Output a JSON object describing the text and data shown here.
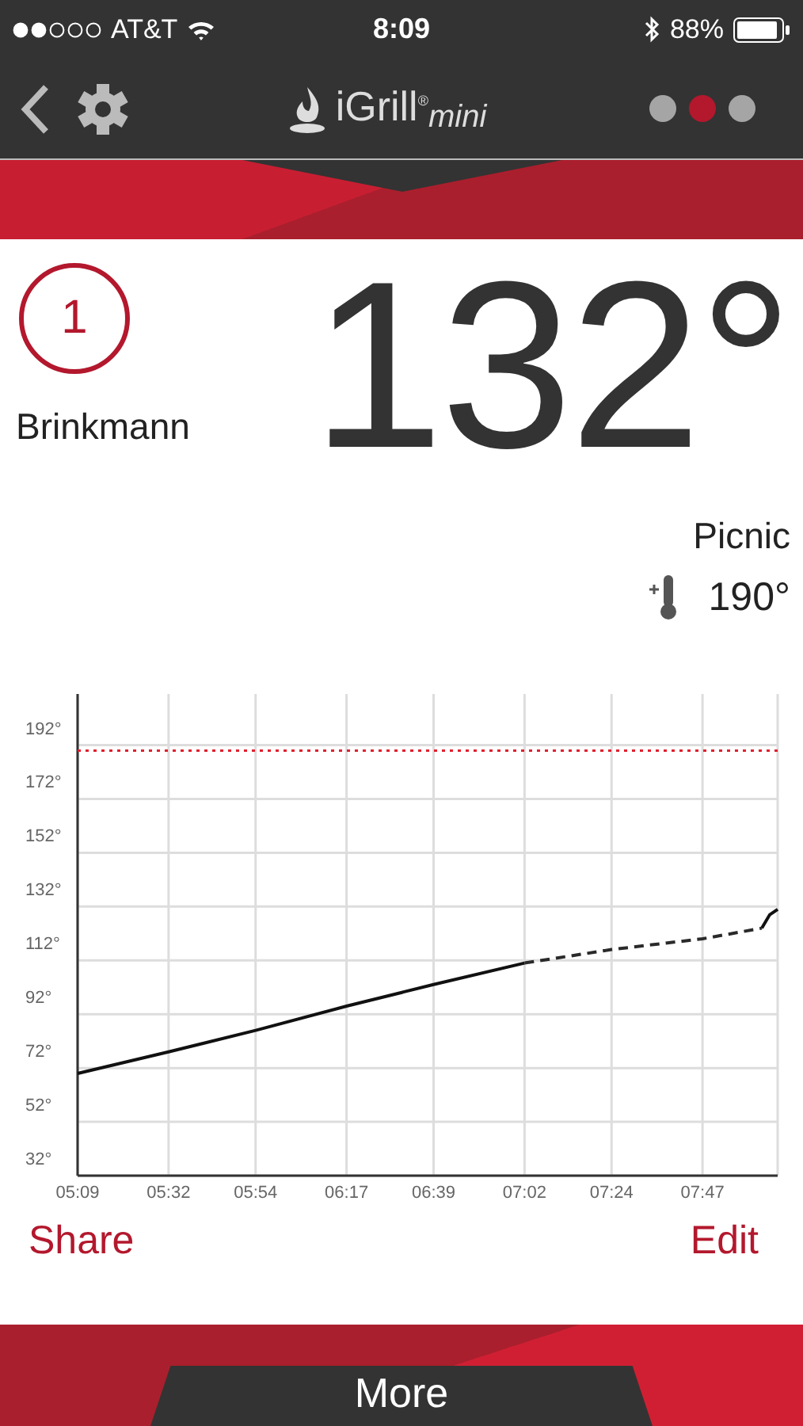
{
  "status_bar": {
    "carrier": "AT&T",
    "time": "8:09",
    "battery": "88%"
  },
  "header": {
    "logo": "iGrill$^{®}$$_{mini}$",
    "pages": [
      {
        "selected": false
      },
      {
        "selected": true
      },
      {
        "selected": false
      }
    ]
  },
  "probe": {
    "number": "1",
    "name": "Brinkmann",
    "temperature": "132°",
    "preset": "Picnic",
    "target": "190°"
  },
  "chart": {
    "chart_data": {
      "type": "line",
      "x": [
        309,
        332,
        354,
        377,
        399,
        422,
        444,
        467,
        482,
        484,
        486
      ],
      "series": [
        {
          "color": "#111111",
          "line_style": "solid",
          "values": [
            70,
            78,
            86,
            95,
            103,
            111,
            null,
            null,
            124,
            129,
            131
          ]
        },
        {
          "color": "#2a2a2a",
          "line_style": "dashed",
          "values": [
            null,
            null,
            null,
            null,
            null,
            111,
            116,
            120,
            124,
            null,
            null
          ]
        },
        {
          "color": "#e0202e",
          "line_style": "dotted",
          "values": [
            190,
            190,
            190,
            190,
            190,
            190,
            190,
            190,
            190,
            190,
            190
          ]
        }
      ],
      "grid": true,
      "xlim": [
        309,
        486
      ],
      "ylim": [
        32,
        211
      ],
      "xticks": [
        {
          "value": 309,
          "label": "05:09"
        },
        {
          "value": 332,
          "label": "05:32"
        },
        {
          "value": 354,
          "label": "05:54"
        },
        {
          "value": 377,
          "label": "06:17"
        },
        {
          "value": 399,
          "label": "06:39"
        },
        {
          "value": 422,
          "label": "07:02"
        },
        {
          "value": 444,
          "label": "07:24"
        },
        {
          "value": 467,
          "label": "07:47"
        }
      ],
      "yticks": [
        {
          "value": 32,
          "label": "32°"
        },
        {
          "value": 52,
          "label": "52°"
        },
        {
          "value": 72,
          "label": "72°"
        },
        {
          "value": 92,
          "label": "92°"
        },
        {
          "value": 112,
          "label": "112°"
        },
        {
          "value": 132,
          "label": "132°"
        },
        {
          "value": 152,
          "label": "152°"
        },
        {
          "value": 172,
          "label": "172°"
        },
        {
          "value": 192,
          "label": "192°"
        }
      ]
    }
  },
  "actions": [
    {
      "label": "Share"
    },
    {
      "label": "Edit"
    }
  ],
  "more_button": "More"
}
